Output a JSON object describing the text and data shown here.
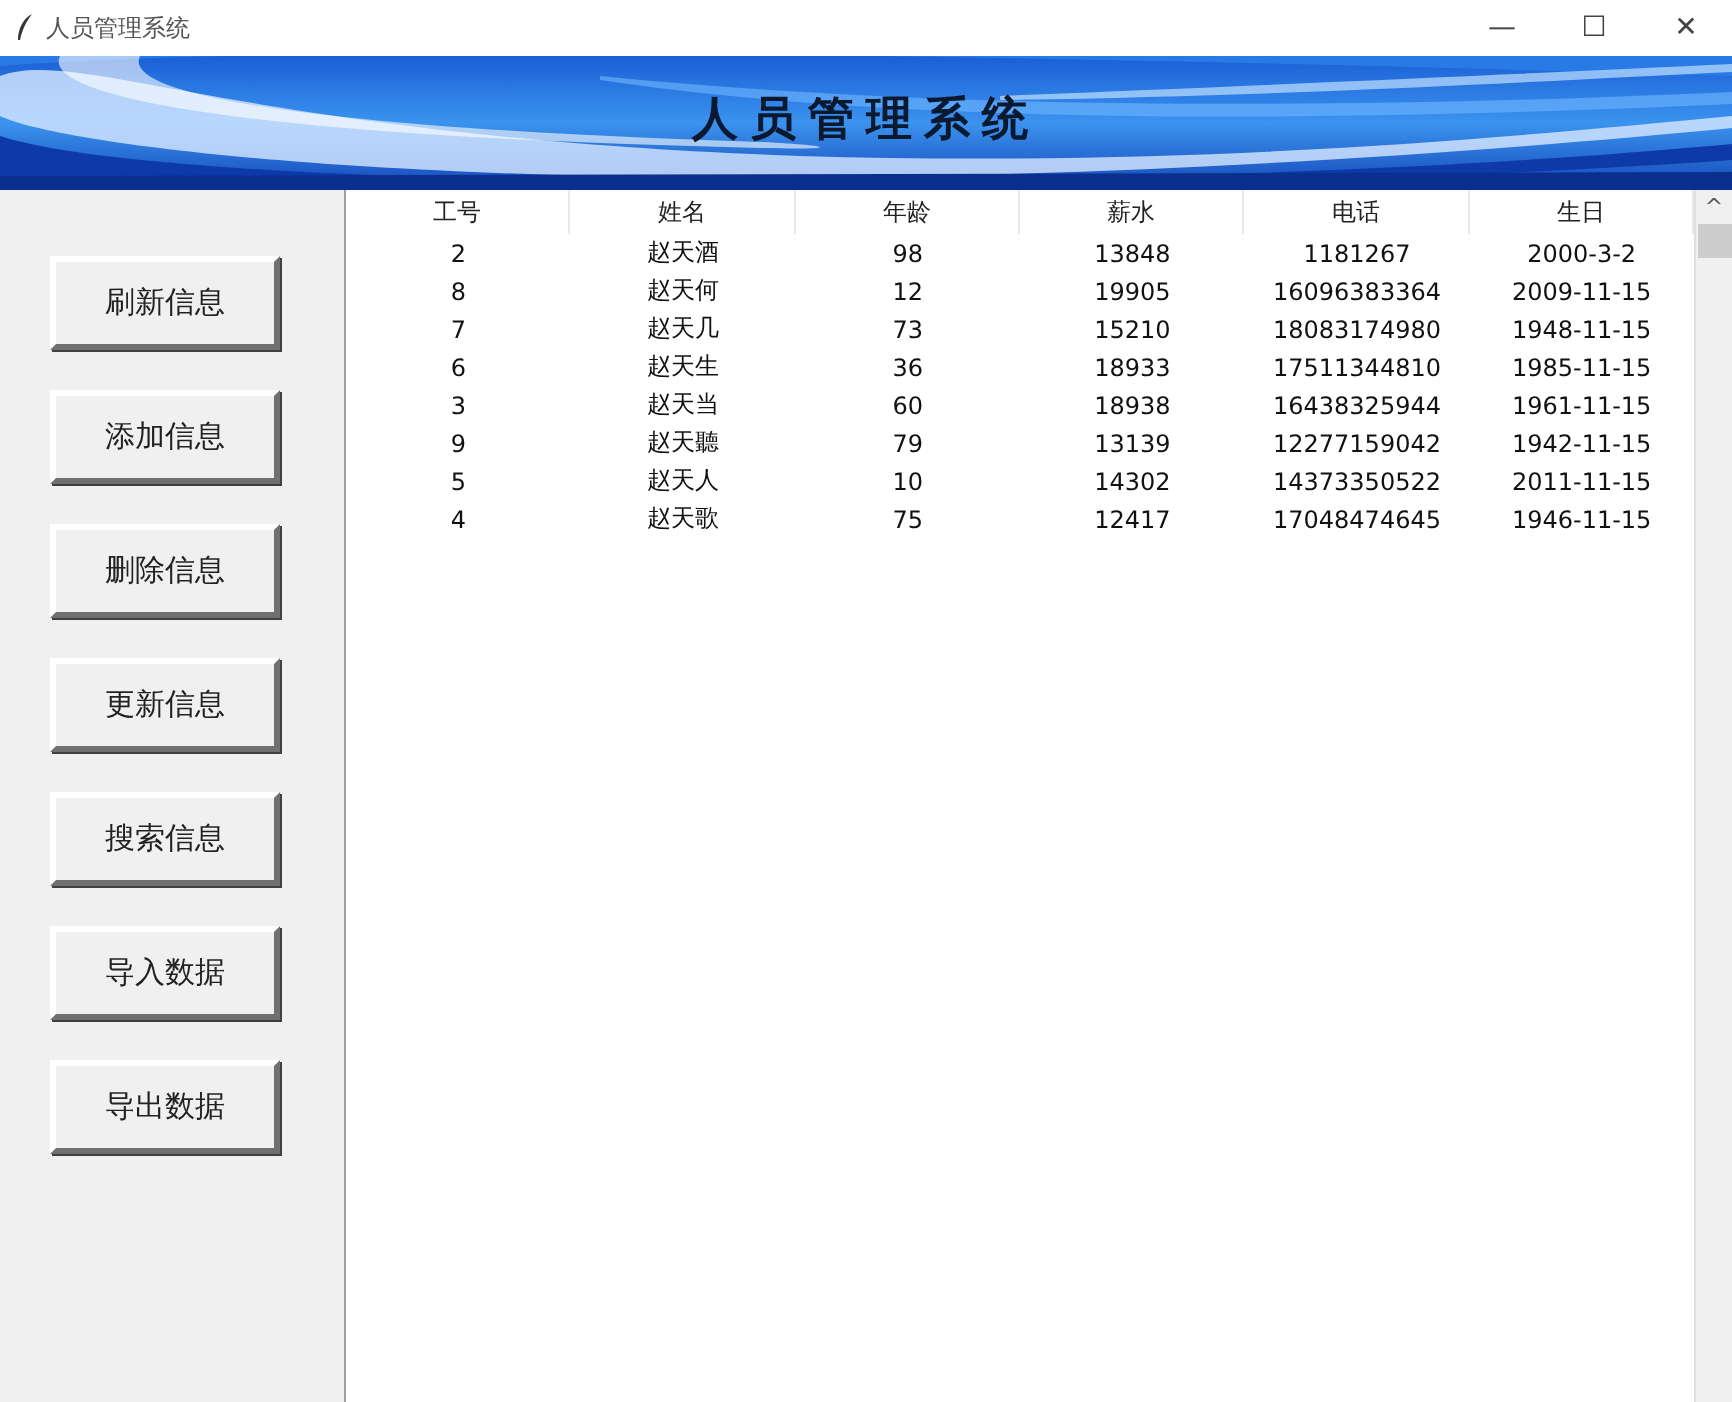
{
  "window": {
    "title": "人员管理系统",
    "controls": [
      "—",
      "☐",
      "✕"
    ]
  },
  "banner": {
    "title": "人员管理系统"
  },
  "sidebar": {
    "buttons": [
      "刷新信息",
      "添加信息",
      "删除信息",
      "更新信息",
      "搜索信息",
      "导入数据",
      "导出数据"
    ]
  },
  "table": {
    "columns": [
      "工号",
      "姓名",
      "年龄",
      "薪水",
      "电话",
      "生日"
    ],
    "rows": [
      [
        "2",
        "赵天酒",
        "98",
        "13848",
        "1181267",
        "2000-3-2"
      ],
      [
        "8",
        "赵天何",
        "12",
        "19905",
        "16096383364",
        "2009-11-15"
      ],
      [
        "7",
        "赵天几",
        "73",
        "15210",
        "18083174980",
        "1948-11-15"
      ],
      [
        "6",
        "赵天生",
        "36",
        "18933",
        "17511344810",
        "1985-11-15"
      ],
      [
        "3",
        "赵天当",
        "60",
        "18938",
        "16438325944",
        "1961-11-15"
      ],
      [
        "9",
        "赵天聽",
        "79",
        "13139",
        "12277159042",
        "1942-11-15"
      ],
      [
        "5",
        "赵天人",
        "10",
        "14302",
        "14373350522",
        "2011-11-15"
      ],
      [
        "4",
        "赵天歌",
        "75",
        "12417",
        "17048474645",
        "1946-11-15"
      ]
    ]
  },
  "scrollbar": {
    "up_arrow": "^"
  }
}
